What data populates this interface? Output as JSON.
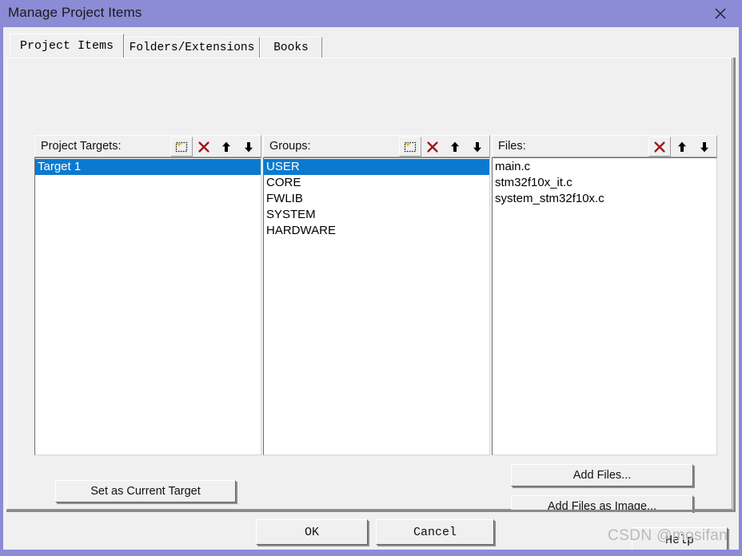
{
  "window": {
    "title": "Manage Project Items",
    "close_icon": "close-icon",
    "frame_color": "#8b8bd6",
    "face_color": "#f0f0f0"
  },
  "tabs": [
    {
      "label": "Project Items",
      "active": true
    },
    {
      "label": "Folders/Extensions",
      "active": false
    },
    {
      "label": "Books",
      "active": false
    }
  ],
  "columns": {
    "targets": {
      "label": "Project Targets:",
      "tools": [
        "new-item-icon",
        "delete-icon",
        "move-up-icon",
        "move-down-icon"
      ],
      "items": [
        {
          "label": "Target 1",
          "selected": true
        }
      ]
    },
    "groups": {
      "label": "Groups:",
      "tools": [
        "new-item-icon",
        "delete-icon",
        "move-up-icon",
        "move-down-icon"
      ],
      "items": [
        {
          "label": "USER",
          "selected": true
        },
        {
          "label": "CORE",
          "selected": false
        },
        {
          "label": "FWLIB",
          "selected": false
        },
        {
          "label": "SYSTEM",
          "selected": false
        },
        {
          "label": "HARDWARE",
          "selected": false
        }
      ]
    },
    "files": {
      "label": "Files:",
      "tools": [
        "delete-icon",
        "move-up-icon",
        "move-down-icon"
      ],
      "items": [
        {
          "label": "main.c",
          "selected": false
        },
        {
          "label": "stm32f10x_it.c",
          "selected": false
        },
        {
          "label": "system_stm32f10x.c",
          "selected": false
        }
      ]
    }
  },
  "buttons": {
    "set_current_target": "Set as Current Target",
    "add_files": "Add Files...",
    "add_files_as_image": "Add Files as Image...",
    "ok": "OK",
    "cancel": "Cancel",
    "help": "Help"
  },
  "watermark": "CSDN @mosifan",
  "colors": {
    "selection_blue": "#0a7ad0",
    "title_purple": "#8b8bd6",
    "delete_red": "#9e1b1b"
  }
}
